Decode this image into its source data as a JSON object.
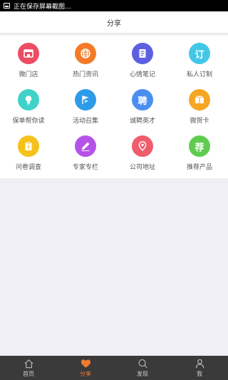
{
  "status_bar": {
    "text": "正在保存屏幕截图..."
  },
  "header": {
    "title": "分享"
  },
  "grid": {
    "items": [
      {
        "label": "微门店",
        "icon": "store-icon",
        "color": "#ec4c64",
        "glyph": ""
      },
      {
        "label": "热门资讯",
        "icon": "globe-icon",
        "color": "#f47a26",
        "glyph": ""
      },
      {
        "label": "心情笔记",
        "icon": "notebook-icon",
        "color": "#5b5fe0",
        "glyph": ""
      },
      {
        "label": "私人订制",
        "icon": "custom-icon",
        "color": "#43c7e8",
        "glyph": "订"
      },
      {
        "label": "保单帮你读",
        "icon": "lightbulb-icon",
        "color": "#3fd2c8",
        "glyph": ""
      },
      {
        "label": "活动召集",
        "icon": "flag-icon",
        "color": "#2e9be8",
        "glyph": ""
      },
      {
        "label": "诚聘英才",
        "icon": "recruit-icon",
        "color": "#4a8ef0",
        "glyph": "聘"
      },
      {
        "label": "微贺卡",
        "icon": "gift-card-icon",
        "color": "#f5a623",
        "glyph": ""
      },
      {
        "label": "问卷调查",
        "icon": "clipboard-icon",
        "color": "#f5c21b",
        "glyph": ""
      },
      {
        "label": "专家专栏",
        "icon": "pen-icon",
        "color": "#b553e8",
        "glyph": ""
      },
      {
        "label": "公司地址",
        "icon": "map-pin-icon",
        "color": "#ef5d6d",
        "glyph": ""
      },
      {
        "label": "推荐产品",
        "icon": "recommend-icon",
        "color": "#5fcc4f",
        "glyph": "荐"
      }
    ]
  },
  "tab_bar": {
    "tabs": [
      {
        "label": "首页",
        "icon": "home-icon"
      },
      {
        "label": "分享",
        "icon": "heart-icon",
        "active": true
      },
      {
        "label": "发现",
        "icon": "search-icon"
      },
      {
        "label": "我",
        "icon": "person-icon"
      }
    ],
    "active_color": "#f07a30"
  }
}
